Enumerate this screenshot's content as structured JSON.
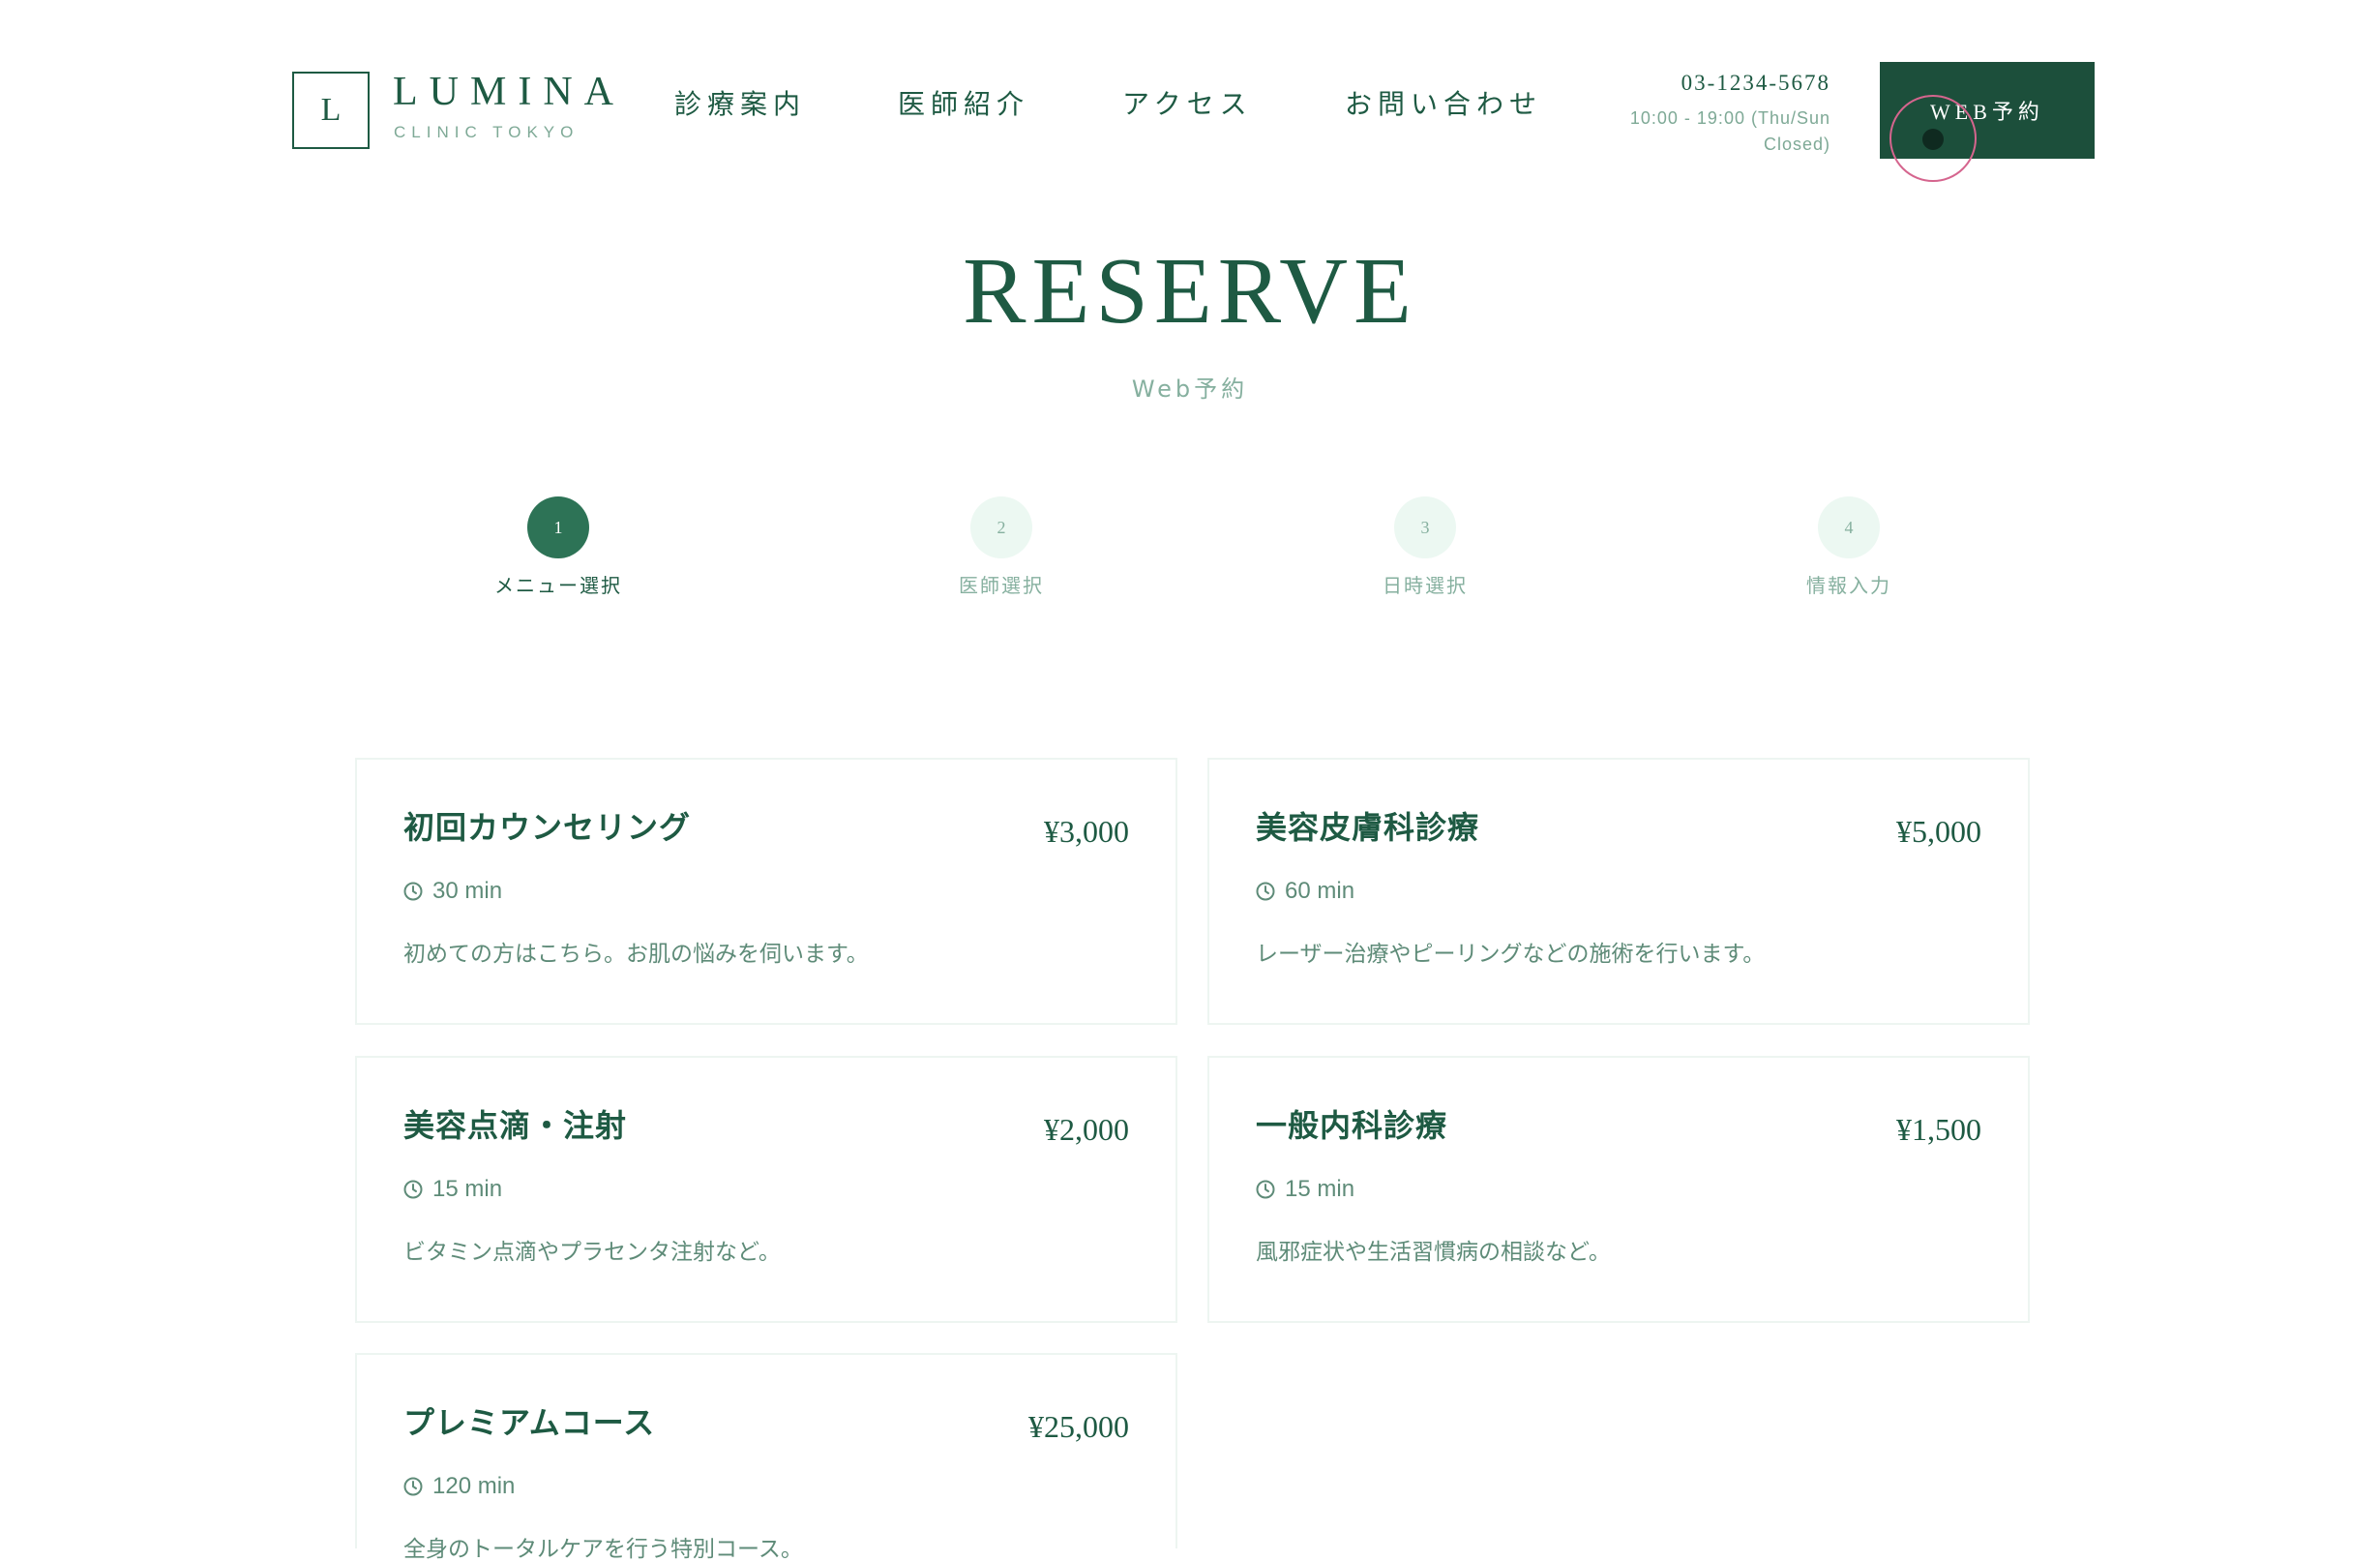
{
  "brand": {
    "logo_mark": "L",
    "name": "LUMINA",
    "subtitle": "CLINIC TOKYO"
  },
  "nav": {
    "items": [
      {
        "label": "診療案内"
      },
      {
        "label": "医師紹介"
      },
      {
        "label": "アクセス"
      },
      {
        "label": "お問い合わせ"
      }
    ]
  },
  "contact": {
    "phone": "03-1234-5678",
    "hours_line1": "10:00 - 19:00 (Thu/Sun",
    "hours_line2": "Closed)"
  },
  "header": {
    "reserve_button": "WEB予約"
  },
  "page": {
    "title": "RESERVE",
    "subtitle": "Web予約"
  },
  "steps": [
    {
      "number": "1",
      "label": "メニュー選択",
      "active": true
    },
    {
      "number": "2",
      "label": "医師選択",
      "active": false
    },
    {
      "number": "3",
      "label": "日時選択",
      "active": false
    },
    {
      "number": "4",
      "label": "情報入力",
      "active": false
    }
  ],
  "menus": [
    {
      "name": "初回カウンセリング",
      "price": "¥3,000",
      "duration": "30 min",
      "description": "初めての方はこちら。お肌の悩みを伺います。"
    },
    {
      "name": "美容皮膚科診療",
      "price": "¥5,000",
      "duration": "60 min",
      "description": "レーザー治療やピーリングなどの施術を行います。"
    },
    {
      "name": "美容点滴・注射",
      "price": "¥2,000",
      "duration": "15 min",
      "description": "ビタミン点滴やプラセンタ注射など。"
    },
    {
      "name": "一般内科診療",
      "price": "¥1,500",
      "duration": "15 min",
      "description": "風邪症状や生活習慣病の相談など。"
    },
    {
      "name": "プレミアムコース",
      "price": "¥25,000",
      "duration": "120 min",
      "description": "全身のトータルケアを行う特別コース。"
    }
  ],
  "icons": {
    "duration": "clock-icon"
  },
  "colors": {
    "primary": "#1c4f3b",
    "accent": "#2d7356",
    "muted": "#86b09f",
    "step_inactive_bg": "#ecf8f2",
    "card_border": "#edf5f1"
  }
}
